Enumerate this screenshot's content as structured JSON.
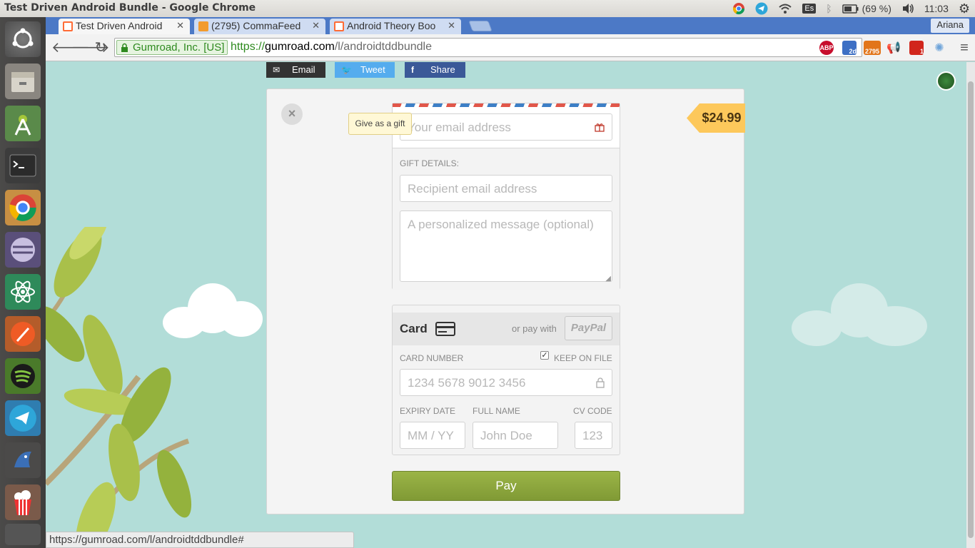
{
  "system_bar": {
    "window_title": "Test Driven Android Bundle - Google Chrome",
    "keyboard_layout": "Es",
    "battery": "(69 %)",
    "clock": "11:03"
  },
  "launcher": {
    "items": [
      "ubuntu-dash-icon",
      "files-icon",
      "android-studio-icon",
      "terminal-icon",
      "chrome-icon",
      "eclipse-icon",
      "atom-icon",
      "postman-icon",
      "spotify-icon",
      "telegram-icon",
      "jabber-icon",
      "popcorn-time-icon",
      "trash-icon"
    ]
  },
  "browser": {
    "tabs": [
      {
        "label": "Test Driven Android",
        "favicon": "gumroad-icon",
        "active": true
      },
      {
        "label": "(2795) CommaFeed",
        "favicon": "rss-icon",
        "active": false
      },
      {
        "label": "Android Theory Boo",
        "favicon": "gumroad-icon",
        "active": false
      }
    ],
    "profile_name": "Ariana",
    "ev_label": "Gumroad, Inc. [US]",
    "url_scheme": "https://",
    "url_host": "gumroad.com",
    "url_path": "/l/androidtddbundle",
    "extensions": [
      {
        "name": "adblock-plus-icon",
        "label": "ABP",
        "color": "#c70d2c"
      },
      {
        "name": "screen-capture-icon",
        "label": "2d",
        "color": "#3d6fc4"
      },
      {
        "name": "rss-feed-icon",
        "label": "2795",
        "color": "#e2751a"
      },
      {
        "name": "announce-icon",
        "label": "",
        "color": "#3c78d8"
      },
      {
        "name": "todoist-icon",
        "label": "1",
        "color": "#d1261c"
      },
      {
        "name": "ufo-icon",
        "label": "",
        "color": "#6da3d9"
      }
    ]
  },
  "share": {
    "email_label": "Email",
    "tweet_label": "Tweet",
    "facebook_label": "Share"
  },
  "checkout": {
    "price": "$24.99",
    "email_placeholder": "Your email address",
    "gift_tooltip": "Give as a gift",
    "gift_details_label": "GIFT DETAILS:",
    "recipient_placeholder": "Recipient email address",
    "message_placeholder": "A personalized message (optional)",
    "card_title": "Card",
    "or_pay_with": "or pay with",
    "paypal_label": "PayPal",
    "card_number_label": "CARD NUMBER",
    "keep_on_file_label": "KEEP ON FILE",
    "keep_on_file_checked": true,
    "card_number_placeholder": "1234 5678 9012 3456",
    "expiry_label": "EXPIRY DATE",
    "fullname_label": "FULL NAME",
    "cvc_label": "CV CODE",
    "expiry_placeholder": "MM / YY",
    "fullname_placeholder": "John Doe",
    "cvc_placeholder": "123",
    "pay_label": "Pay"
  },
  "status_bar": {
    "hover_url": "https://gumroad.com/l/androidtddbundle#"
  },
  "colors": {
    "page_bg": "#b2ddd8",
    "price_tag": "#fdc85b",
    "pay_button": "#8fa83f",
    "tweet": "#55acee",
    "facebook": "#3b5998"
  }
}
